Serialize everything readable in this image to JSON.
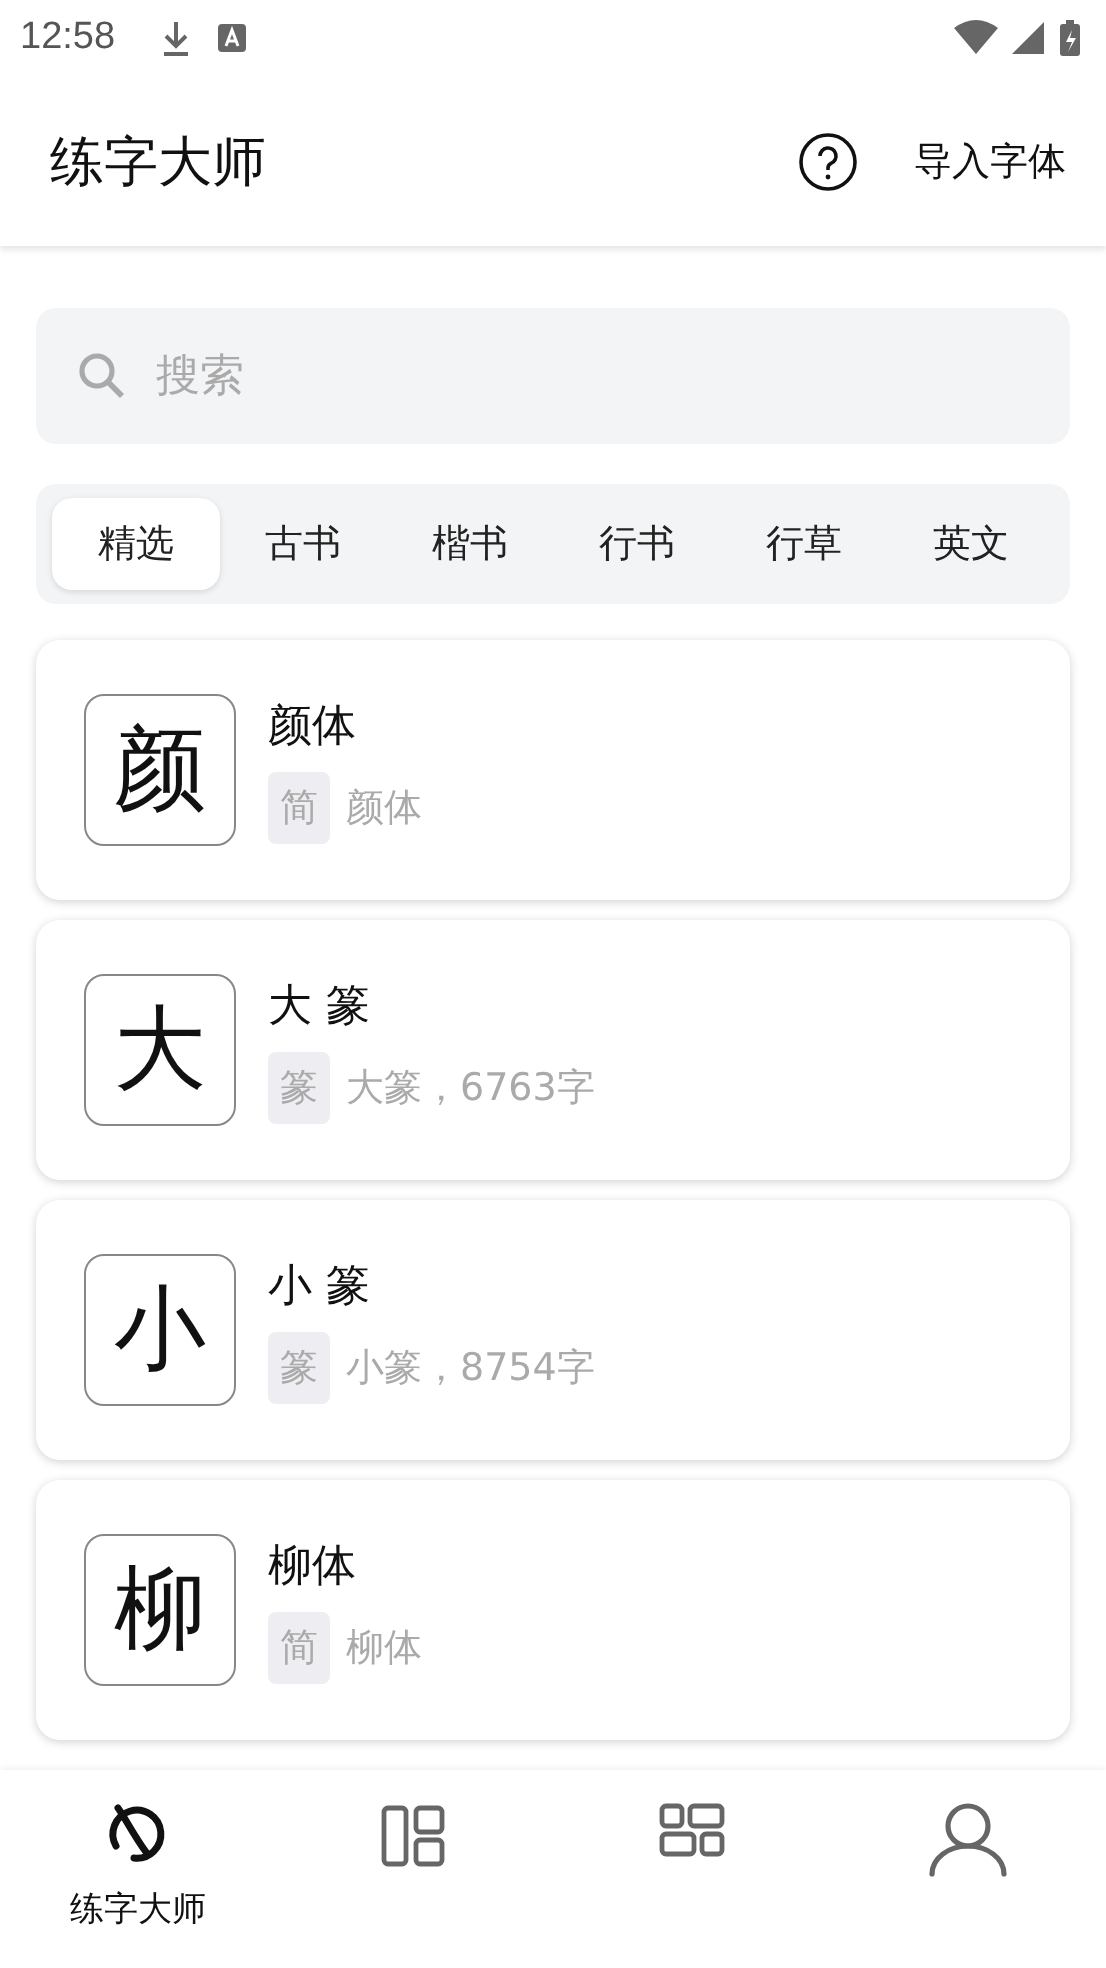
{
  "status_bar": {
    "time": "12:58"
  },
  "app_bar": {
    "title": "练字大师",
    "action": "导入字体"
  },
  "search": {
    "placeholder": "搜索"
  },
  "tabs": [
    {
      "label": "精选",
      "selected": true
    },
    {
      "label": "古书",
      "selected": false
    },
    {
      "label": "楷书",
      "selected": false
    },
    {
      "label": "行书",
      "selected": false
    },
    {
      "label": "行草",
      "selected": false
    },
    {
      "label": "英文",
      "selected": false
    }
  ],
  "fonts": [
    {
      "preview": "颜",
      "name": "颜体",
      "tag": "简",
      "description": "颜体"
    },
    {
      "preview": "大",
      "name": "大 篆",
      "tag": "篆",
      "description": "大篆，6763字"
    },
    {
      "preview": "小",
      "name": "小 篆",
      "tag": "篆",
      "description": "小篆，8754字"
    },
    {
      "preview": "柳",
      "name": "柳体",
      "tag": "简",
      "description": "柳体"
    }
  ],
  "bottom_nav": [
    {
      "kind": "logo",
      "label": "练字大师",
      "selected": true
    },
    {
      "kind": "layout",
      "selected": false
    },
    {
      "kind": "grid",
      "selected": false
    },
    {
      "kind": "profile",
      "selected": false
    }
  ]
}
